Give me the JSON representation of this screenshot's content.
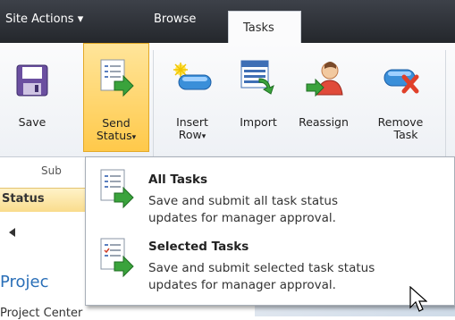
{
  "tabs": {
    "site_actions": "Site Actions ▾",
    "browse": "Browse",
    "tasks": "Tasks"
  },
  "ribbon": {
    "save": "Save",
    "send_line1": "Send",
    "send_line2": "Status",
    "insert_line1": "Insert",
    "insert_line2": "Row",
    "import": "Import",
    "reassign": "Reassign",
    "remove_line1": "Remove",
    "remove_line2": "Task",
    "group_label": "Sub"
  },
  "page": {
    "status_label": "Status",
    "project_title": "Projec",
    "project_center": "Project Center"
  },
  "menu": {
    "items": [
      {
        "title": "All Tasks",
        "desc_line1": "Save and submit all task status",
        "desc_line2": "updates for manager approval."
      },
      {
        "title": "Selected Tasks",
        "desc_line1": "Save and submit selected task status",
        "desc_line2": "updates for manager approval."
      }
    ]
  }
}
